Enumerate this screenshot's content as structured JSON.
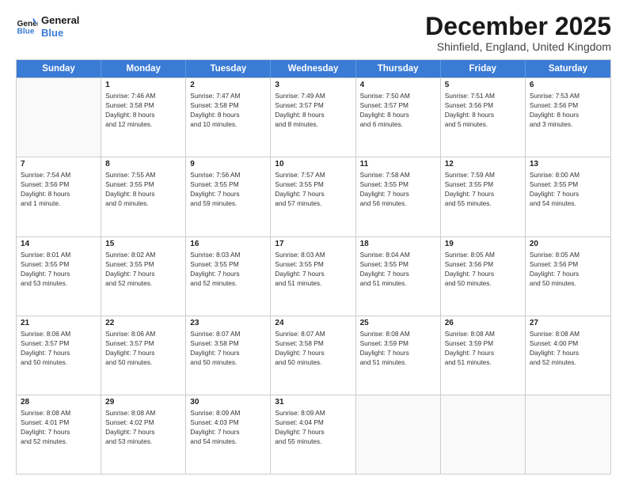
{
  "header": {
    "logo_line1": "General",
    "logo_line2": "Blue",
    "title": "December 2025",
    "subtitle": "Shinfield, England, United Kingdom"
  },
  "weekdays": [
    "Sunday",
    "Monday",
    "Tuesday",
    "Wednesday",
    "Thursday",
    "Friday",
    "Saturday"
  ],
  "rows": [
    [
      {
        "day": "",
        "sunrise": "",
        "sunset": "",
        "daylight": ""
      },
      {
        "day": "1",
        "sunrise": "Sunrise: 7:46 AM",
        "sunset": "Sunset: 3:58 PM",
        "daylight": "Daylight: 8 hours",
        "daylight2": "and 12 minutes."
      },
      {
        "day": "2",
        "sunrise": "Sunrise: 7:47 AM",
        "sunset": "Sunset: 3:58 PM",
        "daylight": "Daylight: 8 hours",
        "daylight2": "and 10 minutes."
      },
      {
        "day": "3",
        "sunrise": "Sunrise: 7:49 AM",
        "sunset": "Sunset: 3:57 PM",
        "daylight": "Daylight: 8 hours",
        "daylight2": "and 8 minutes."
      },
      {
        "day": "4",
        "sunrise": "Sunrise: 7:50 AM",
        "sunset": "Sunset: 3:57 PM",
        "daylight": "Daylight: 8 hours",
        "daylight2": "and 6 minutes."
      },
      {
        "day": "5",
        "sunrise": "Sunrise: 7:51 AM",
        "sunset": "Sunset: 3:56 PM",
        "daylight": "Daylight: 8 hours",
        "daylight2": "and 5 minutes."
      },
      {
        "day": "6",
        "sunrise": "Sunrise: 7:53 AM",
        "sunset": "Sunset: 3:56 PM",
        "daylight": "Daylight: 8 hours",
        "daylight2": "and 3 minutes."
      }
    ],
    [
      {
        "day": "7",
        "sunrise": "Sunrise: 7:54 AM",
        "sunset": "Sunset: 3:56 PM",
        "daylight": "Daylight: 8 hours",
        "daylight2": "and 1 minute."
      },
      {
        "day": "8",
        "sunrise": "Sunrise: 7:55 AM",
        "sunset": "Sunset: 3:55 PM",
        "daylight": "Daylight: 8 hours",
        "daylight2": "and 0 minutes."
      },
      {
        "day": "9",
        "sunrise": "Sunrise: 7:56 AM",
        "sunset": "Sunset: 3:55 PM",
        "daylight": "Daylight: 7 hours",
        "daylight2": "and 59 minutes."
      },
      {
        "day": "10",
        "sunrise": "Sunrise: 7:57 AM",
        "sunset": "Sunset: 3:55 PM",
        "daylight": "Daylight: 7 hours",
        "daylight2": "and 57 minutes."
      },
      {
        "day": "11",
        "sunrise": "Sunrise: 7:58 AM",
        "sunset": "Sunset: 3:55 PM",
        "daylight": "Daylight: 7 hours",
        "daylight2": "and 56 minutes."
      },
      {
        "day": "12",
        "sunrise": "Sunrise: 7:59 AM",
        "sunset": "Sunset: 3:55 PM",
        "daylight": "Daylight: 7 hours",
        "daylight2": "and 55 minutes."
      },
      {
        "day": "13",
        "sunrise": "Sunrise: 8:00 AM",
        "sunset": "Sunset: 3:55 PM",
        "daylight": "Daylight: 7 hours",
        "daylight2": "and 54 minutes."
      }
    ],
    [
      {
        "day": "14",
        "sunrise": "Sunrise: 8:01 AM",
        "sunset": "Sunset: 3:55 PM",
        "daylight": "Daylight: 7 hours",
        "daylight2": "and 53 minutes."
      },
      {
        "day": "15",
        "sunrise": "Sunrise: 8:02 AM",
        "sunset": "Sunset: 3:55 PM",
        "daylight": "Daylight: 7 hours",
        "daylight2": "and 52 minutes."
      },
      {
        "day": "16",
        "sunrise": "Sunrise: 8:03 AM",
        "sunset": "Sunset: 3:55 PM",
        "daylight": "Daylight: 7 hours",
        "daylight2": "and 52 minutes."
      },
      {
        "day": "17",
        "sunrise": "Sunrise: 8:03 AM",
        "sunset": "Sunset: 3:55 PM",
        "daylight": "Daylight: 7 hours",
        "daylight2": "and 51 minutes."
      },
      {
        "day": "18",
        "sunrise": "Sunrise: 8:04 AM",
        "sunset": "Sunset: 3:55 PM",
        "daylight": "Daylight: 7 hours",
        "daylight2": "and 51 minutes."
      },
      {
        "day": "19",
        "sunrise": "Sunrise: 8:05 AM",
        "sunset": "Sunset: 3:56 PM",
        "daylight": "Daylight: 7 hours",
        "daylight2": "and 50 minutes."
      },
      {
        "day": "20",
        "sunrise": "Sunrise: 8:05 AM",
        "sunset": "Sunset: 3:56 PM",
        "daylight": "Daylight: 7 hours",
        "daylight2": "and 50 minutes."
      }
    ],
    [
      {
        "day": "21",
        "sunrise": "Sunrise: 8:06 AM",
        "sunset": "Sunset: 3:57 PM",
        "daylight": "Daylight: 7 hours",
        "daylight2": "and 50 minutes."
      },
      {
        "day": "22",
        "sunrise": "Sunrise: 8:06 AM",
        "sunset": "Sunset: 3:57 PM",
        "daylight": "Daylight: 7 hours",
        "daylight2": "and 50 minutes."
      },
      {
        "day": "23",
        "sunrise": "Sunrise: 8:07 AM",
        "sunset": "Sunset: 3:58 PM",
        "daylight": "Daylight: 7 hours",
        "daylight2": "and 50 minutes."
      },
      {
        "day": "24",
        "sunrise": "Sunrise: 8:07 AM",
        "sunset": "Sunset: 3:58 PM",
        "daylight": "Daylight: 7 hours",
        "daylight2": "and 50 minutes."
      },
      {
        "day": "25",
        "sunrise": "Sunrise: 8:08 AM",
        "sunset": "Sunset: 3:59 PM",
        "daylight": "Daylight: 7 hours",
        "daylight2": "and 51 minutes."
      },
      {
        "day": "26",
        "sunrise": "Sunrise: 8:08 AM",
        "sunset": "Sunset: 3:59 PM",
        "daylight": "Daylight: 7 hours",
        "daylight2": "and 51 minutes."
      },
      {
        "day": "27",
        "sunrise": "Sunrise: 8:08 AM",
        "sunset": "Sunset: 4:00 PM",
        "daylight": "Daylight: 7 hours",
        "daylight2": "and 52 minutes."
      }
    ],
    [
      {
        "day": "28",
        "sunrise": "Sunrise: 8:08 AM",
        "sunset": "Sunset: 4:01 PM",
        "daylight": "Daylight: 7 hours",
        "daylight2": "and 52 minutes."
      },
      {
        "day": "29",
        "sunrise": "Sunrise: 8:08 AM",
        "sunset": "Sunset: 4:02 PM",
        "daylight": "Daylight: 7 hours",
        "daylight2": "and 53 minutes."
      },
      {
        "day": "30",
        "sunrise": "Sunrise: 8:09 AM",
        "sunset": "Sunset: 4:03 PM",
        "daylight": "Daylight: 7 hours",
        "daylight2": "and 54 minutes."
      },
      {
        "day": "31",
        "sunrise": "Sunrise: 8:09 AM",
        "sunset": "Sunset: 4:04 PM",
        "daylight": "Daylight: 7 hours",
        "daylight2": "and 55 minutes."
      },
      {
        "day": "",
        "sunrise": "",
        "sunset": "",
        "daylight": "",
        "daylight2": ""
      },
      {
        "day": "",
        "sunrise": "",
        "sunset": "",
        "daylight": "",
        "daylight2": ""
      },
      {
        "day": "",
        "sunrise": "",
        "sunset": "",
        "daylight": "",
        "daylight2": ""
      }
    ]
  ]
}
